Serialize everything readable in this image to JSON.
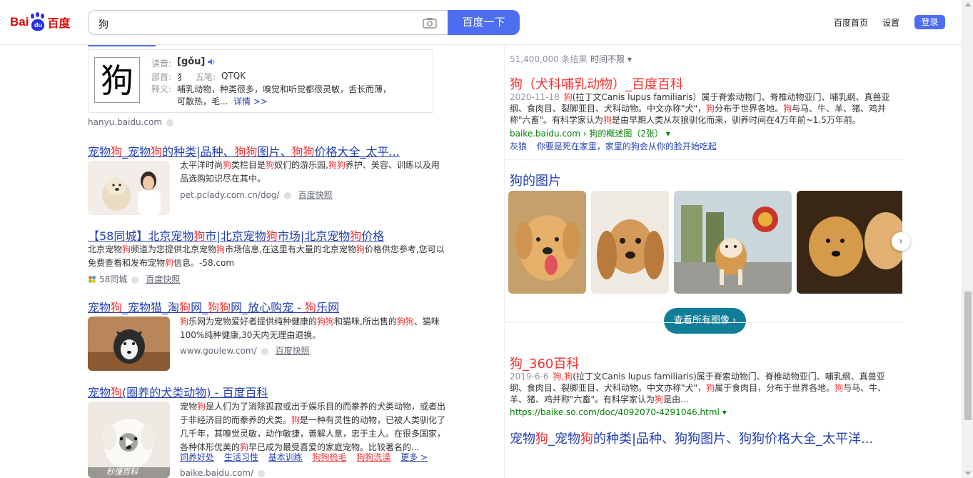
{
  "header": {
    "logo_bai": "Bai",
    "logo_du": "du",
    "logo_cn": "百度",
    "query": "狗",
    "search_button": "百度一下",
    "nav_home": "百度首页",
    "nav_settings": "设置",
    "login": "登录"
  },
  "hanyu": {
    "char": "狗",
    "reading_label": "读音:",
    "reading": "[gǒu]",
    "radical_label": "部首:",
    "radical": "犭",
    "strokes_label": "五笔:",
    "strokes": "QTQK",
    "meaning_label": "释义:",
    "meaning_1": "哺乳动物，种类很多，嗅觉和听觉都很灵敏，舌长而薄，",
    "meaning_2": "可散热，毛...",
    "detail_link": "详情 >>",
    "source": "hanyu.baidu.com"
  },
  "results": [
    {
      "title_parts": [
        "宠物",
        "狗",
        "_宠物",
        "狗",
        "的种类|品种、",
        "狗狗",
        "图片、",
        "狗狗",
        "价格大全_太平..."
      ],
      "abstract_parts": [
        "太平洋时尚",
        "狗",
        "类栏目是",
        "狗",
        "奴们的游乐园,",
        "狗狗",
        "养护、美容、训练以及用品选购知识尽在其中。"
      ],
      "source": "pet.pclady.com.cn/dog/",
      "kuaizhao": "百度快照"
    },
    {
      "title_parts": [
        "【58同城】北京宠物",
        "狗",
        "市|北京宠物",
        "狗",
        "市场|北京宠物",
        "狗",
        "价格"
      ],
      "abstract_parts": [
        "北京宠物",
        "狗",
        "频道为您提供北京宠物",
        "狗",
        "市场信息,在这里有大量的北京宠物",
        "狗",
        "价格供您参考,您可以免费查看和发布宠物",
        "狗",
        "信息。-58.com"
      ],
      "source": "58同城",
      "kuaizhao": "百度快照"
    },
    {
      "title_parts": [
        "宠物",
        "狗",
        "_宠物猫_淘",
        "狗",
        "网_",
        "狗狗",
        "网_放心购宠 - ",
        "狗",
        "乐网"
      ],
      "abstract_parts": [
        "",
        "狗",
        "乐网为宠物爱好者提供纯种健康的",
        "狗狗",
        "和猫咪,所出售的",
        "狗狗",
        "、猫咪100%纯种健康,30天内无理由退换。"
      ],
      "source": "www.goulew.com/",
      "kuaizhao": "百度快照"
    },
    {
      "title_parts": [
        "宠物",
        "狗",
        "(圈养的犬类动物) - 百度百科"
      ],
      "abstract_parts": [
        "宠物",
        "狗",
        "是人们为了消除孤寂或出于娱乐目的而豢养的犬类动物，或者出于非经济目的而豢养的犬类。",
        "狗",
        "是一种有灵性的动物，已被人类驯化了几千年，其嗅觉灵敏，动作敏捷，善解人意，忠于主人。在很多国家，各种体形优美的",
        "狗",
        "早已成为最受喜爱的家庭宠物。比较著名的..."
      ],
      "links": [
        "饲养好处",
        "生活习性",
        "基本训练",
        "狗狗梳毛",
        "狗狗洗澡",
        "更多 >"
      ],
      "source": "baike.baidu.com/",
      "img_caption": "秒懂百科"
    }
  ],
  "right": {
    "count": "51,400,000 条结果",
    "time_filter": "时间不限",
    "baike_title": "狗（犬科哺乳动物）_百度百科",
    "baike_date": "2020-11-18",
    "baike_abs": [
      "狗",
      "(拉丁文Canis lupus familiaris）属于脊索动物门、脊椎动物亚门、哺乳纲、真兽亚纲、食肉目、裂脚亚目、犬科动物。中文亦称\"犬\"，",
      "狗",
      "分布于世界各地。",
      "狗",
      "与马、牛、羊、猪、鸡并称\"六畜\"。有科学家认为",
      "狗",
      "是由早期人类从灰狼驯化而来，驯养时间在4万年前~1.5万年前。"
    ],
    "baike_src": "baike.baidu.com › 狗的概述图（2张）",
    "baike_related": [
      "灰狼",
      "你要是死在家里，家里的狗会从你的脸开始吃起"
    ],
    "images_title": "狗的图片",
    "view_all": "查看所有图像",
    "so_title": "狗_360百科",
    "so_date": "2019-6-6",
    "so_abs": [
      "狗,狗",
      "(拉丁文Canis lupus familiaris)属于脊索动物门、脊椎动物亚门、哺乳纲、真兽亚纲、食肉目、裂脚亚目、犬科动物。中文亦称\"犬\"，",
      "狗",
      "属于食肉目，分布于世界各地。",
      "狗",
      "与马、牛、羊、猪、鸡并称\"六畜\"。有科学家认为",
      "狗",
      "是由..."
    ],
    "so_src": "https://baike.so.com/doc/4092070-4291046.html",
    "last_title": [
      "宠物",
      "狗",
      "_宠物",
      "狗",
      "的种类|品种、狗狗图片、狗狗价格大全_太平洋..."
    ]
  },
  "colors": {
    "brand_blue": "#4e6ef2",
    "link_blue": "#2440b3",
    "highlight_red": "#f73131",
    "source_green": "#008000",
    "teal_button": "#107e98"
  }
}
